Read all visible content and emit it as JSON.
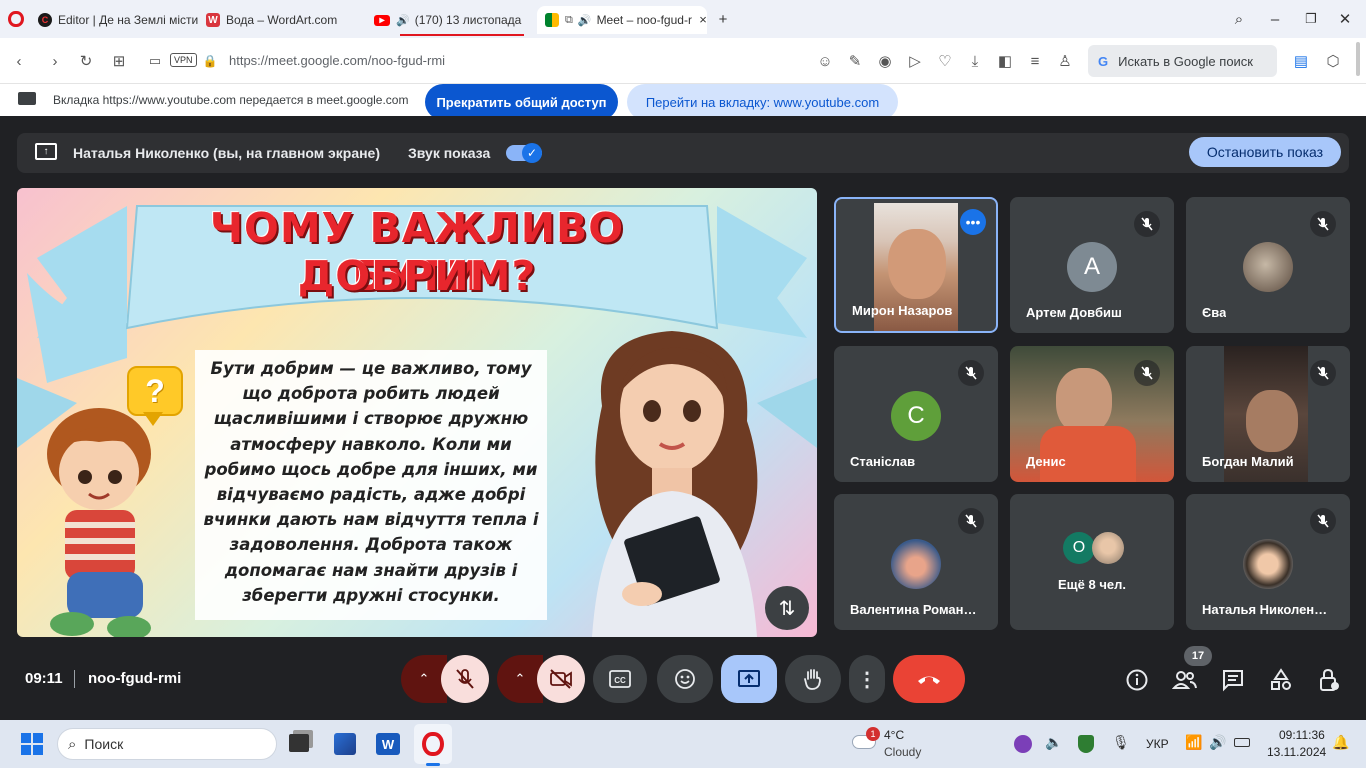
{
  "browser": {
    "tabs": [
      {
        "label": "Editor | Де на Землі місти",
        "favicon": "editor-favicon"
      },
      {
        "label": "Вода – WordArt.com",
        "favicon": "wordart-favicon"
      },
      {
        "label": "(170) 13 листопада -",
        "favicon": "youtube-favicon"
      },
      {
        "label": "Meet – noo-fgud-r",
        "favicon": "meet-favicon"
      }
    ],
    "url": "https://meet.google.com/noo-fgud-rmi",
    "vpn_label": "VPN",
    "search_placeholder": "Искать в Google поиск"
  },
  "share_notice": {
    "text": "Вкладка https://www.youtube.com передается в meet.google.com",
    "stop_button": "Прекратить общий доступ",
    "goto_button": "Перейти на вкладку: www.youtube.com"
  },
  "presenting": {
    "presenter": "Наталья Николенко (вы, на главном экране)",
    "audio_label": "Звук показа",
    "stop_button": "Остановить показ"
  },
  "slide": {
    "title_line1": "ЧОМУ ВАЖЛИВО БУТИ",
    "title_line2": "ДОБРИМ?",
    "question_mark": "?",
    "body": "Бути добрим — це важливо, тому що доброта робить людей щасливішими і створює дружню атмосферу навколо. Коли ми робимо щось добре для інших, ми відчуваємо радість, адже добрі вчинки дають нам відчуття тепла і задоволення. Доброта також допомагає нам знайти друзів і зберегти дружні стосунки."
  },
  "participants": [
    {
      "name": "Мирон Назаров",
      "type": "video",
      "color": "#b88a70"
    },
    {
      "name": "Артем Довбиш",
      "type": "letter",
      "letter": "А",
      "color": "#7e8a93"
    },
    {
      "name": "Єва",
      "type": "photo",
      "color": "#8a7a6a"
    },
    {
      "name": "Станіслав",
      "type": "letter",
      "letter": "С",
      "color": "#5f9f3a"
    },
    {
      "name": "Денис",
      "type": "video",
      "color": "#9a7a5a"
    },
    {
      "name": "Богдан Малий",
      "type": "video",
      "color": "#4a3a32"
    },
    {
      "name": "Валентина Роман…",
      "type": "photo",
      "color": "#6a8ab0"
    },
    {
      "name": "Ещё 8 чел.",
      "type": "more",
      "letter": "О",
      "color": "#137a63"
    },
    {
      "name": "Наталья Николен…",
      "type": "photo",
      "color": "#b08a70"
    }
  ],
  "meeting": {
    "time": "09:11",
    "code": "noo-fgud-rmi",
    "participant_count": "17"
  },
  "colors": {
    "accent": "#8ab4f8",
    "end_call": "#ea4335",
    "muted": "#f9dedc"
  },
  "taskbar": {
    "search_label": "Поиск",
    "weather_temp": "4°C",
    "weather_desc": "Cloudy",
    "weather_badge": "1",
    "lang": "УКР",
    "clock_time": "09:11:36",
    "clock_date": "13.11.2024"
  }
}
